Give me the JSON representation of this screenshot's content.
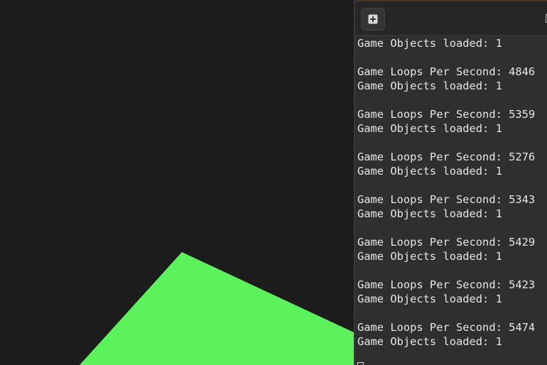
{
  "viewport": {
    "background_color": "#1c1c1c",
    "shape_color": "#5cf25c"
  },
  "terminal": {
    "new_tab_icon": "plus-square-icon",
    "lines": [
      "Game Objects loaded: 1",
      "",
      "Game Loops Per Second: 4846",
      "Game Objects loaded: 1",
      "",
      "Game Loops Per Second: 5359",
      "Game Objects loaded: 1",
      "",
      "Game Loops Per Second: 5276",
      "Game Objects loaded: 1",
      "",
      "Game Loops Per Second: 5343",
      "Game Objects loaded: 1",
      "",
      "Game Loops Per Second: 5429",
      "Game Objects loaded: 1",
      "",
      "Game Loops Per Second: 5423",
      "Game Objects loaded: 1",
      "",
      "Game Loops Per Second: 5474",
      "Game Objects loaded: 1"
    ]
  }
}
